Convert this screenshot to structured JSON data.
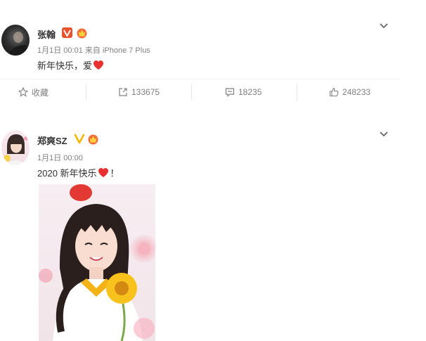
{
  "posts": [
    {
      "author": "张翰",
      "meta": "1月1日 00:01 来自 iPhone 7 Plus",
      "text": "新年快乐，爱",
      "actions": {
        "favorite": "收藏",
        "repost": "133675",
        "comment": "18235",
        "like": "248233"
      }
    },
    {
      "author": "郑爽SZ",
      "meta": "1月1日 00:00",
      "text": "2020 新年快乐",
      "text_suffix": "！"
    }
  ],
  "colors": {
    "verified_red": "#e8522e",
    "verified_gold": "#f7b500",
    "heart": "#e8312f",
    "meta_grey": "#808080"
  }
}
